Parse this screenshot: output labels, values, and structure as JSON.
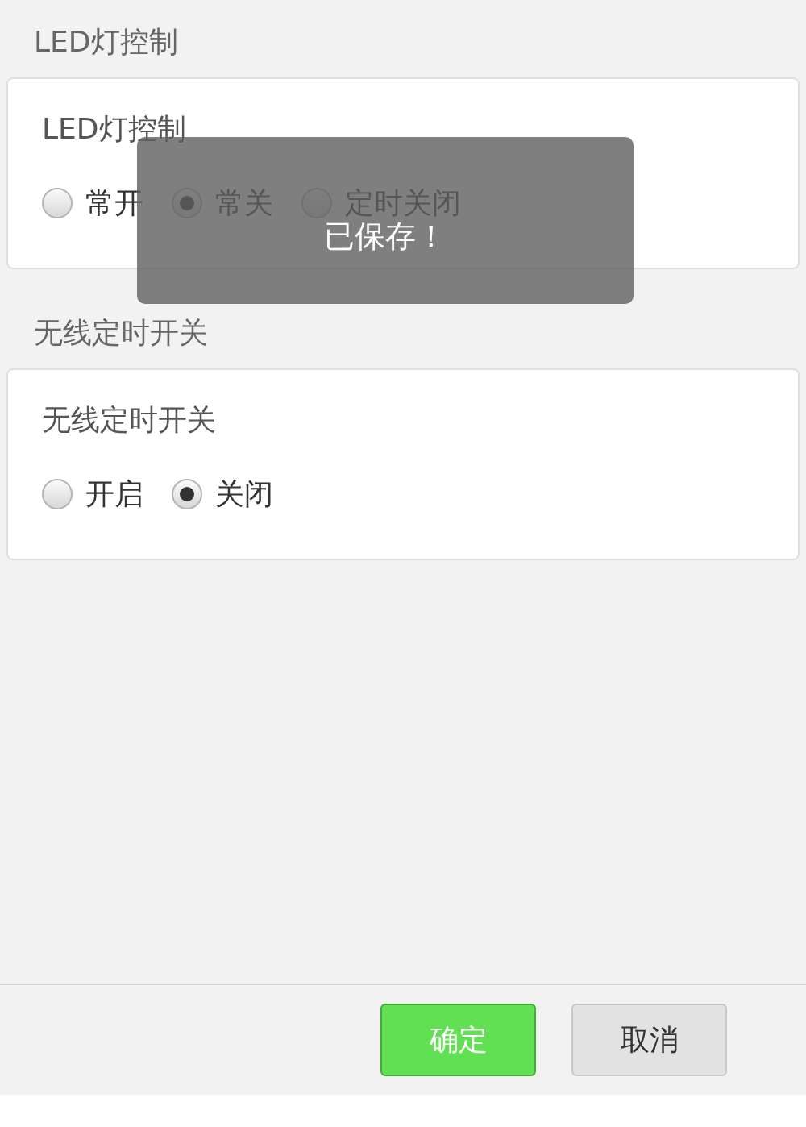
{
  "sections": [
    {
      "heading": "LED灯控制",
      "card_title": "LED灯控制",
      "options": [
        {
          "label": "常开",
          "selected": false
        },
        {
          "label": "常关",
          "selected": true
        },
        {
          "label": "定时关闭",
          "selected": false
        }
      ]
    },
    {
      "heading": "无线定时开关",
      "card_title": "无线定时开关",
      "options": [
        {
          "label": "开启",
          "selected": false
        },
        {
          "label": "关闭",
          "selected": true
        }
      ]
    }
  ],
  "buttons": [
    {
      "label": "确定",
      "kind": "primary"
    },
    {
      "label": "取消",
      "kind": "secondary"
    }
  ],
  "toast": {
    "text": "已保存！"
  }
}
